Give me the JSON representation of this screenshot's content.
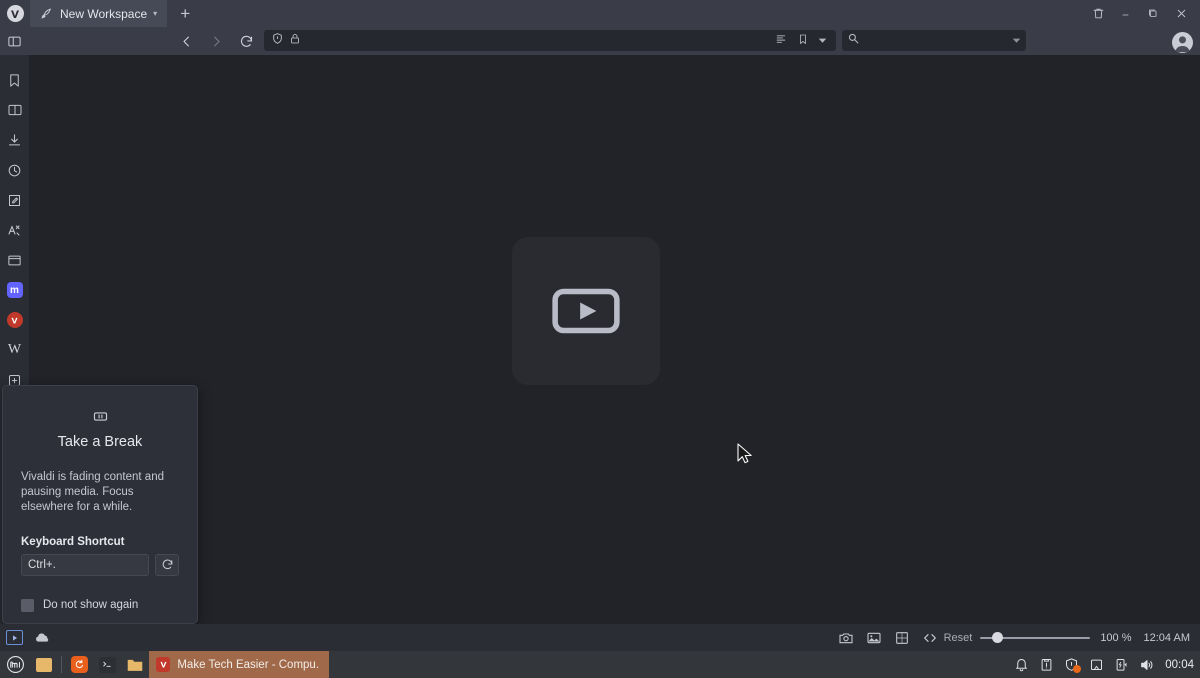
{
  "window": {
    "tabbar": {
      "vivaldi_menu_icon": "vivaldi-logo-icon",
      "workspace": {
        "icon": "rocket-icon",
        "label": "New Workspace",
        "caret": "▾"
      },
      "new_tab_label": "+",
      "controls": [
        {
          "name": "delete-workspace",
          "icon": "trash-icon",
          "glyph": ""
        },
        {
          "name": "minimize",
          "icon": "minimize-icon",
          "glyph": ""
        },
        {
          "name": "maximize",
          "icon": "maximize-icon",
          "glyph": ""
        },
        {
          "name": "close",
          "icon": "close-icon",
          "glyph": "×"
        }
      ]
    },
    "toolbar": {
      "panel_toggle_icon": "panel-toggle-icon",
      "back_label": "‹",
      "forward_label": "›",
      "reload_icon": "reload-icon",
      "url": {
        "shield_icon": "shield-icon",
        "lock_icon": "lock-icon",
        "value": "",
        "placeholder": "",
        "reader_icon": "reader-view-icon",
        "bookmark_icon": "bookmark-icon",
        "dropdown_icon": "chevron-down-icon"
      },
      "search": {
        "icon": "search-icon",
        "value": "",
        "placeholder": "",
        "dropdown_icon": "chevron-down-icon"
      },
      "profile_icon": "account-avatar-icon"
    },
    "panel": {
      "items": [
        {
          "name": "bookmarks",
          "icon": "bookmark-panel-icon",
          "badge": null
        },
        {
          "name": "reading-list",
          "icon": "reading-list-icon",
          "badge": null
        },
        {
          "name": "downloads",
          "icon": "download-icon",
          "badge": null
        },
        {
          "name": "history",
          "icon": "history-clock-icon",
          "badge": null
        },
        {
          "name": "notes",
          "icon": "notes-pencil-icon",
          "badge": null
        },
        {
          "name": "translate",
          "icon": "translate-icon",
          "badge": null
        },
        {
          "name": "window-panel",
          "icon": "window-panel-icon",
          "badge": null
        },
        {
          "name": "mastodon",
          "icon": "mastodon-web-panel-icon",
          "badge": {
            "letter": "m",
            "color": "#6364ff"
          }
        },
        {
          "name": "vivaldi-social",
          "icon": "vivaldi-web-panel-icon",
          "badge": {
            "letter": "V",
            "color": "#c0392b"
          }
        },
        {
          "name": "wikipedia",
          "icon": "wikipedia-web-panel-icon",
          "badge": {
            "letter": "W",
            "color": "transparent"
          }
        },
        {
          "name": "add-web-panel",
          "icon": "add-panel-plus-icon",
          "badge": null
        }
      ]
    },
    "content": {
      "video_placeholder_icon": "video-play-placeholder-icon",
      "cursor_icon": "mouse-pointer-icon"
    },
    "break_dialog": {
      "icon": "pause-icon",
      "title": "Take a Break",
      "body": "Vivaldi is fading content and pausing media. Focus elsewhere for a while.",
      "shortcut_label": "Keyboard Shortcut",
      "shortcut_value": "Ctrl+.",
      "shortcut_placeholder": "Ctrl+.",
      "reset_icon": "reset-refresh-icon",
      "checkbox_label": "Do not show again"
    },
    "statusbar": {
      "icons": [
        {
          "name": "capture-page",
          "icon": "camera-icon"
        },
        {
          "name": "image-toggle",
          "icon": "image-icon"
        },
        {
          "name": "tile-tabs",
          "icon": "tiling-square-icon"
        },
        {
          "name": "developer-tools",
          "icon": "code-brackets-icon"
        }
      ],
      "reset_label": "Reset",
      "zoom_value": "100 %",
      "zoom_percent": 100,
      "clock": "12:04 AM"
    }
  },
  "desktop": {
    "taskbar": {
      "menu_icon": "linux-mint-menu-icon",
      "launchers": [
        {
          "name": "show-desktop",
          "icon": "show-desktop-icon",
          "color": "#e8b86a"
        },
        {
          "name": "firefox",
          "icon": "firefox-icon",
          "color": "#e8601c"
        },
        {
          "name": "terminal",
          "icon": "terminal-icon",
          "color": "#2c2f33"
        },
        {
          "name": "files",
          "icon": "folder-icon",
          "color": "#e8b86a"
        }
      ],
      "window_item": {
        "icon": "vivaldi-icon",
        "label": "Make Tech Easier - Compu..."
      },
      "tray": [
        {
          "name": "notifications",
          "icon": "bell-icon",
          "dot": false
        },
        {
          "name": "clipboard",
          "icon": "clipboard-icon",
          "dot": false
        },
        {
          "name": "update-manager",
          "icon": "shield-update-icon",
          "dot": true
        },
        {
          "name": "network",
          "icon": "network-icon",
          "dot": false
        },
        {
          "name": "power",
          "icon": "battery-charging-icon",
          "dot": false
        },
        {
          "name": "volume",
          "icon": "speaker-volume-icon",
          "dot": false
        }
      ],
      "clock": "00:04"
    }
  },
  "colors": {
    "chrome": "#3a3d48",
    "page_bg": "#222329",
    "panel_bg": "#2b2d35",
    "dialog_bg": "#2e3039",
    "taskbar_bg": "#33363b",
    "task_active": "#a06a4a",
    "accent_orange": "#e8681c",
    "mastodon": "#6364ff",
    "vivaldi_red": "#c0392b"
  }
}
